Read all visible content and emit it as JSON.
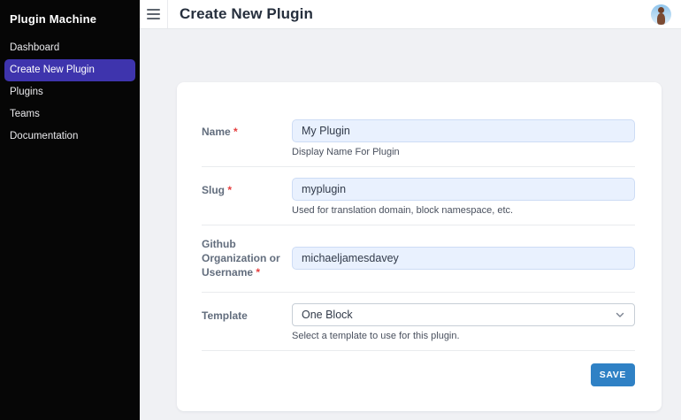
{
  "sidebar": {
    "title": "Plugin Machine",
    "items": [
      {
        "label": "Dashboard",
        "active": false
      },
      {
        "label": "Create New Plugin",
        "active": true
      },
      {
        "label": "Plugins",
        "active": false
      },
      {
        "label": "Teams",
        "active": false
      },
      {
        "label": "Documentation",
        "active": false
      }
    ]
  },
  "header": {
    "title": "Create New Plugin"
  },
  "form": {
    "fields": [
      {
        "label": "Name",
        "required_mark": "*",
        "value": "My Plugin",
        "help": "Display Name For Plugin",
        "type": "text"
      },
      {
        "label": "Slug",
        "required_mark": "*",
        "value": "myplugin",
        "help": "Used for translation domain, block namespace, etc.",
        "type": "text"
      },
      {
        "label": "Github Organization or Username",
        "required_mark": "*",
        "value": "michaeljamesdavey",
        "help": "",
        "type": "text"
      },
      {
        "label": "Template",
        "required_mark": "",
        "value": "One Block",
        "help": "Select a template to use for this plugin.",
        "type": "select"
      }
    ],
    "save_label": "SAVE"
  },
  "colors": {
    "sidebar_bg": "#060606",
    "sidebar_active": "#3e34ad",
    "content_bg": "#f0f1f4",
    "input_bg": "#e9f1fe",
    "save_button": "#2f81c5",
    "required": "#e53e3e"
  }
}
